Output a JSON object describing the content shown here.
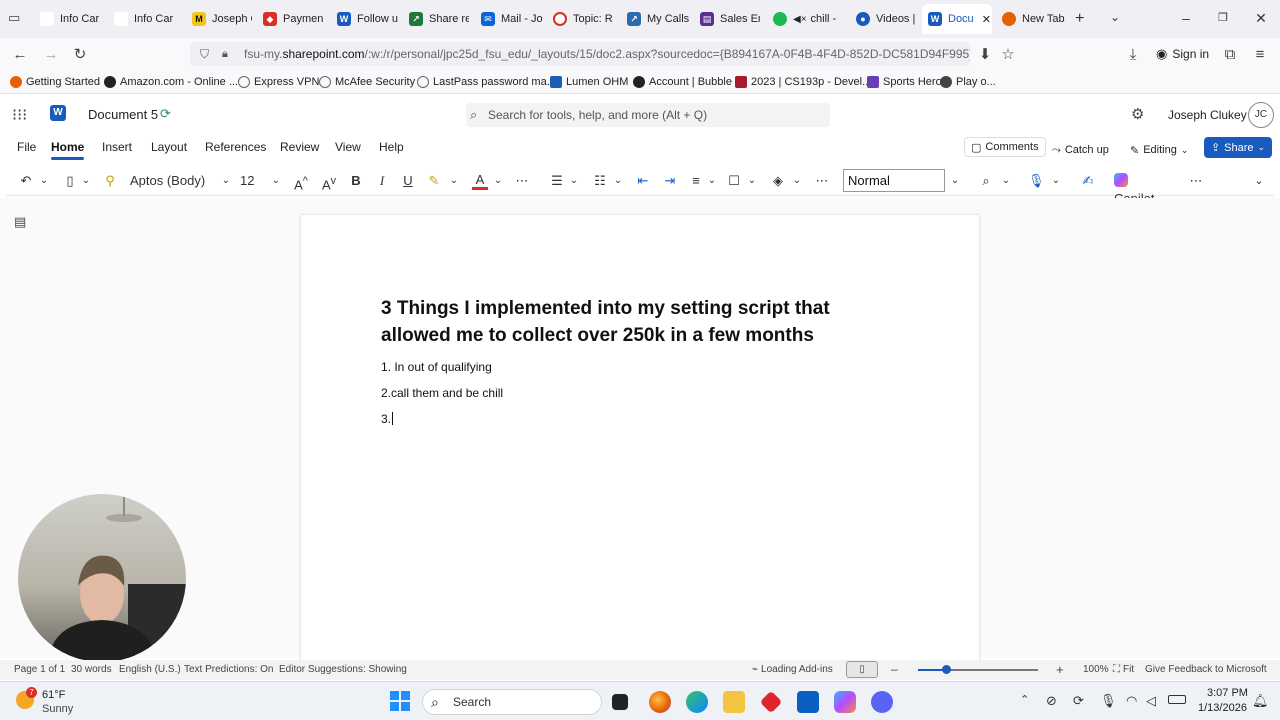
{
  "browser": {
    "tabs": [
      {
        "label": "Info Car",
        "color": "#e8e8e8"
      },
      {
        "label": "Info Car",
        "color": "#e8e8e8"
      },
      {
        "label": "Joseph C",
        "color": "#f5c518"
      },
      {
        "label": "Payment",
        "color": "#d93025"
      },
      {
        "label": "Follow u",
        "color": "#185abd"
      },
      {
        "label": "Share re",
        "color": "#1f7a3a"
      },
      {
        "label": "Mail - Jo",
        "color": "#0a64d8"
      },
      {
        "label": "Topic: R",
        "color": "#d93025"
      },
      {
        "label": "My Calls",
        "color": "#2b6cb0"
      },
      {
        "label": "Sales En",
        "color": "#5b2d8e"
      },
      {
        "label": "chill -",
        "color": "#1db954"
      },
      {
        "label": "Videos |",
        "color": "#185abd"
      },
      {
        "label": "Docu",
        "color": "#185abd"
      },
      {
        "label": "New Tab",
        "color": "#e66000"
      }
    ],
    "url_prefix": "fsu-my.",
    "url_domain": "sharepoint.com",
    "url_rest": "/:w:/r/personal/jpc25d_fsu_edu/_layouts/15/doc2.aspx?sourcedoc={B894167A-0F4B-4F4D-852D-DC581D94F995}&file=",
    "sign_in": "Sign in",
    "bookmarks": [
      {
        "label": "Getting Started",
        "color": "#e66000"
      },
      {
        "label": "Amazon.com - Online ...",
        "color": "#222222"
      },
      {
        "label": "Express VPN",
        "color": "#888888"
      },
      {
        "label": "McAfee Security",
        "color": "#888888"
      },
      {
        "label": "LastPass password ma...",
        "color": "#888888"
      },
      {
        "label": "Lumen OHM",
        "color": "#1a5fb4"
      },
      {
        "label": "Account | Bubble",
        "color": "#222222"
      },
      {
        "label": "2023 | CS193p - Devel...",
        "color": "#a51c30"
      },
      {
        "label": "Sports Hero",
        "color": "#6a3fb5"
      },
      {
        "label": "Play o...",
        "color": "#444444"
      }
    ]
  },
  "word": {
    "doc_name": "Document 5",
    "search_placeholder": "Search for tools, help, and more (Alt + Q)",
    "user_name": "Joseph Clukey",
    "user_initials": "JC",
    "ribbon_tabs": [
      "File",
      "Home",
      "Insert",
      "Layout",
      "References",
      "Review",
      "View",
      "Help"
    ],
    "comments": "Comments",
    "catch_up": "Catch up",
    "editing": "Editing",
    "share": "Share",
    "font_name": "Aptos (Body)",
    "font_size": "12",
    "style": "Normal",
    "copilot": "Copilot"
  },
  "document": {
    "title": "3 Things I implemented into my setting script that allowed me to collect over 250k in a few months",
    "lines": [
      "1. In out of qualifying",
      "2.call them and be chill",
      "3."
    ]
  },
  "status": {
    "page": "Page 1 of 1",
    "words": "30 words",
    "language": "English (U.S.)",
    "text_predictions": "Text Predictions: On",
    "editor_suggestions": "Editor Suggestions: Showing",
    "loading_addins": "Loading Add-ins",
    "zoom": "100%",
    "fit": "Fit",
    "feedback": "Give Feedback to Microsoft"
  },
  "taskbar": {
    "temperature": "61°F",
    "weather": "Sunny",
    "weather_badge": "7",
    "search": "Search",
    "time": "3:07 PM",
    "date": "1/13/2026"
  },
  "colors": {
    "accent": "#185abd",
    "share_bg": "#185abd"
  }
}
